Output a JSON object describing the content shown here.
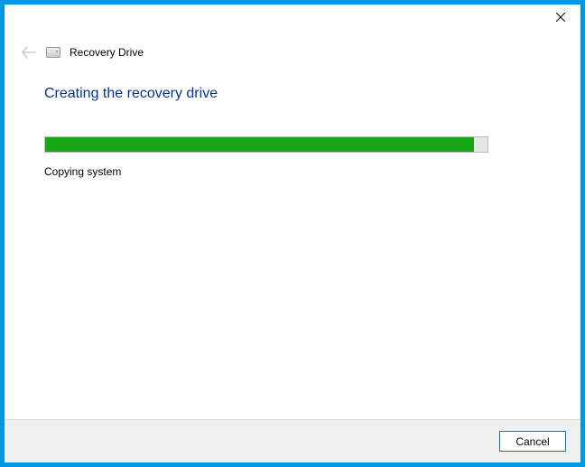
{
  "header": {
    "app_title": "Recovery Drive"
  },
  "main": {
    "heading": "Creating the recovery drive",
    "status": "Copying system",
    "progress_percent": 97
  },
  "footer": {
    "cancel_label": "Cancel"
  }
}
